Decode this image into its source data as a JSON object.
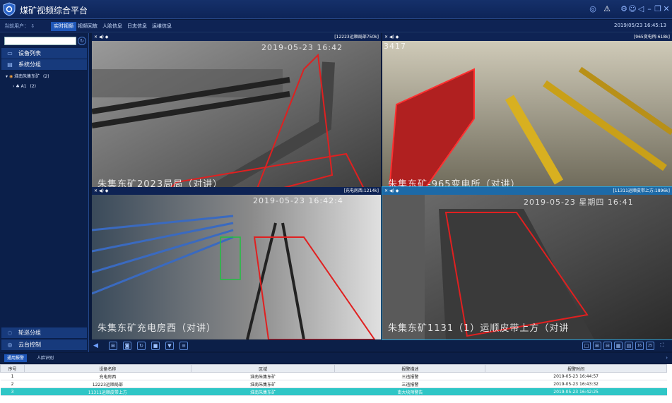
{
  "app": {
    "title": "煤矿视频综合平台"
  },
  "menu": {
    "current_user": "当前用户：",
    "tabs": [
      {
        "label": "实时视频",
        "active": true
      },
      {
        "label": "视频回放"
      },
      {
        "label": "人脸信息"
      },
      {
        "label": "日志信息"
      },
      {
        "label": "运维信息"
      }
    ],
    "datetime": "2019/05/23 16:45:13"
  },
  "sidebar": {
    "search_placeholder": "",
    "top_items": [
      {
        "label": "设备列表",
        "icon": "monitor-icon"
      },
      {
        "label": "系统分组",
        "icon": "folder-icon"
      }
    ],
    "tree": [
      {
        "label": "淮南朱集东矿",
        "count": "(2)",
        "level": 0
      },
      {
        "label": "A1",
        "count": "(2)",
        "level": 1
      }
    ],
    "bottom_items": [
      {
        "label": "轮巡分组",
        "icon": "cycle-icon"
      },
      {
        "label": "云台控制",
        "icon": "ptz-icon"
      }
    ]
  },
  "videos": [
    {
      "camera": "[12223运顺局部750k]",
      "overlay": "朱集东矿2023局局（对讲）",
      "timestamp": "2019-05-23 16:42"
    },
    {
      "camera": "[965变电所:618k]",
      "overlay": "朱集东矿-965变电所（对讲）",
      "timestamp": "3417"
    },
    {
      "camera": "[充电房西:1214k]",
      "overlay": "朱集东矿充电房西（对讲）",
      "timestamp": "2019-05-23  16:42:4"
    },
    {
      "camera": "[11311运顺皮带上方:1896k]",
      "overlay": "朱集东矿1131（1）运顺皮带上方（对讲",
      "timestamp": "2019-05-23  星期四  16:41",
      "selected": true
    }
  ],
  "bottom_tabs": [
    {
      "label": "通用报警",
      "active": true
    },
    {
      "label": "人脸识别"
    }
  ],
  "alarms": {
    "headers": [
      "序号",
      "设备名称",
      "区域",
      "报警描述",
      "报警时间"
    ],
    "rows": [
      [
        "1",
        "充电房西",
        "淮南朱集东矿",
        "三违报警",
        "2019-05-23 16:44:57"
      ],
      [
        "2",
        "12223运顺局部",
        "淮南朱集东矿",
        "三违报警",
        "2019-05-23 16:43:32"
      ],
      [
        "3",
        "11311运顺皮带上方",
        "淮南朱集东矿",
        "南大块预警告",
        "2019-05-23 16:42:25"
      ]
    ],
    "selected_row": 2
  },
  "colors": {
    "accent": "#1e56b8",
    "selected_row": "#2fc6c6",
    "roi": "#e02020"
  }
}
